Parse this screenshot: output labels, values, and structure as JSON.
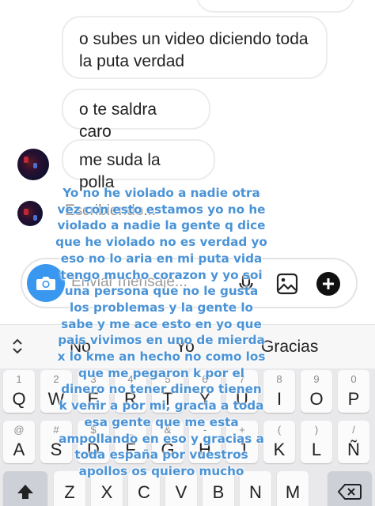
{
  "chat": {
    "messages": [
      "o subes un video diciendo toda la puta verdad",
      "o te saldra caro",
      "me suda la polla"
    ],
    "typing_indicator": "Escribiendo..."
  },
  "composer": {
    "placeholder": "Enviar mensaje..."
  },
  "suggestions": [
    "No",
    "Yo",
    "Gracias"
  ],
  "keyboard": {
    "row1": [
      {
        "hint": "1",
        "key": "Q"
      },
      {
        "hint": "2",
        "key": "W"
      },
      {
        "hint": "3",
        "key": "E"
      },
      {
        "hint": "4",
        "key": "R"
      },
      {
        "hint": "5",
        "key": "T"
      },
      {
        "hint": "6",
        "key": "Y"
      },
      {
        "hint": "7",
        "key": "U"
      },
      {
        "hint": "8",
        "key": "I"
      },
      {
        "hint": "9",
        "key": "O"
      },
      {
        "hint": "0",
        "key": "P"
      }
    ],
    "row2": [
      {
        "hint": "@",
        "key": "A"
      },
      {
        "hint": "#",
        "key": "S"
      },
      {
        "hint": "$",
        "key": "D"
      },
      {
        "hint": "_",
        "key": "F"
      },
      {
        "hint": "&",
        "key": "G"
      },
      {
        "hint": "-",
        "key": "H"
      },
      {
        "hint": "+",
        "key": "J"
      },
      {
        "hint": "(",
        "key": "K"
      },
      {
        "hint": ")",
        "key": "L"
      },
      {
        "hint": "/",
        "key": "Ñ"
      }
    ],
    "row3": [
      {
        "hint": "",
        "key": "Z"
      },
      {
        "hint": "",
        "key": "X"
      },
      {
        "hint": "",
        "key": "C"
      },
      {
        "hint": "",
        "key": "V"
      },
      {
        "hint": "",
        "key": "B"
      },
      {
        "hint": "",
        "key": "N"
      },
      {
        "hint": "",
        "key": "M"
      }
    ]
  },
  "overlay_text": "Yo no he violado a nadie otra vez con esto estamos yo no he violado a nadie la gente q dice que he violado no es verdad yo eso no lo aria en mi puta vida tengo mucho corazon y yo soi una persona que no le gusta los problemas y la gente lo sabe y me ace esto en yo que pais vivimos en uno de mierda x lo kme an hecho no como los que me pegaron k por el dinero no tener dinero tienen k venir a por mi, gracia a toda esa gente que me esta ampollando en eso y gracias a toda españa por vuestros apollos os quiero mucho",
  "colors": {
    "accent": "#3a97ef",
    "overlay_text": "#4a93d6",
    "keyboard_bg": "#e9e9ec"
  }
}
